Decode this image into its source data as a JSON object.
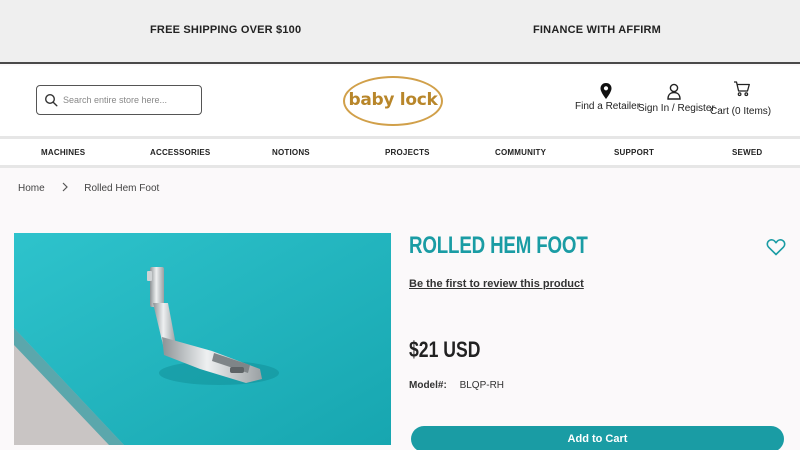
{
  "promo": {
    "shipping": "FREE SHIPPING OVER $100",
    "finance": "FINANCE WITH AFFIRM"
  },
  "header": {
    "search_placeholder": "Search entire store here...",
    "logo_text": "baby lock",
    "find_retailer": "Find a Retailer",
    "sign_in": "Sign In / Register",
    "cart": "Cart  (0 Items)"
  },
  "nav": {
    "items": [
      {
        "label": "MACHINES"
      },
      {
        "label": "ACCESSORIES"
      },
      {
        "label": "NOTIONS"
      },
      {
        "label": "PROJECTS"
      },
      {
        "label": "COMMUNITY"
      },
      {
        "label": "SUPPORT"
      },
      {
        "label": "SEWED"
      }
    ]
  },
  "breadcrumb": {
    "home": "Home",
    "current": "Rolled Hem Foot"
  },
  "product": {
    "title": "ROLLED HEM FOOT",
    "review_link": "Be the first to review this product",
    "price": "$21 USD",
    "model_label": "Model#:",
    "model_value": "BLQP-RH",
    "add_to_cart": "Add to Cart"
  },
  "colors": {
    "accent": "#1a9ca4",
    "logo_gold": "#b8862a",
    "promo_bg": "#efefef"
  },
  "icons": {
    "search": "search-icon",
    "retailer": "map-pin-icon",
    "account": "user-icon",
    "cart": "cart-icon",
    "wishlist": "heart-icon",
    "breadcrumb_sep": "chevron-right-icon"
  }
}
